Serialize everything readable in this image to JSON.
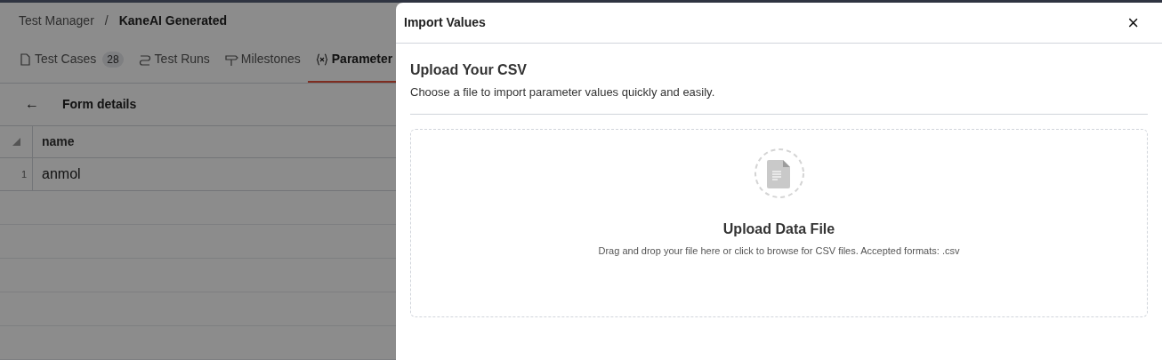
{
  "breadcrumb": [
    "Test Manager",
    "KaneAI Generated"
  ],
  "breadcrumb_separator": "/",
  "tabs": [
    {
      "label": "Test Cases",
      "count": "28",
      "selected": false
    },
    {
      "label": "Test Runs",
      "selected": false
    },
    {
      "label": "Milestones",
      "selected": false
    },
    {
      "label": "Parameter",
      "selected": true
    }
  ],
  "form": {
    "back": "←",
    "title": "Form details"
  },
  "table": {
    "columns": [
      "name"
    ],
    "rows": [
      {
        "index": "1",
        "cells": [
          "anmol"
        ]
      }
    ]
  },
  "drawer": {
    "title": "Import Values",
    "close": "×",
    "heading": "Upload Your CSV",
    "subtitle": "Choose a file to import parameter values quickly and easily.",
    "dropzone": {
      "title": "Upload Data File",
      "hint": "Drag and drop your file here or click to browse for CSV files. Accepted formats: .csv"
    }
  }
}
